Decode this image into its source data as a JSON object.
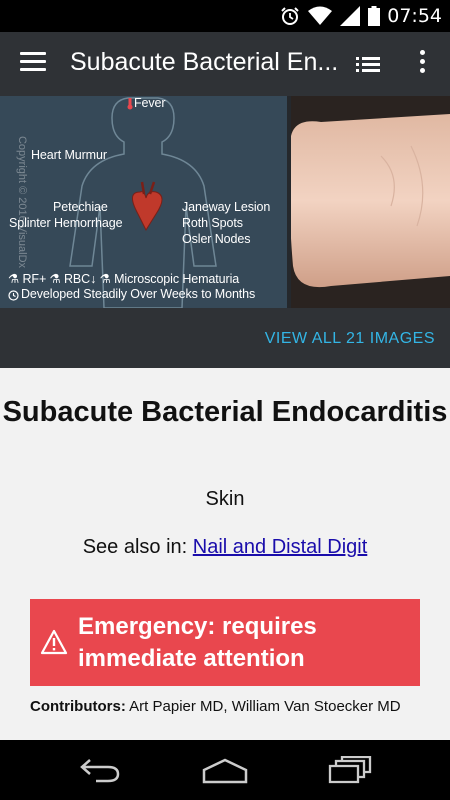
{
  "status_bar": {
    "time": "07:54"
  },
  "app_bar": {
    "title": "Subacute Bacterial En..."
  },
  "gallery": {
    "diagram_labels": {
      "fever": "Fever",
      "heart_murmur": "Heart Murmur",
      "petechiae": "Petechiae",
      "splinter": "Splinter Hemorrhage",
      "janeway": "Janeway Lesion",
      "roth": "Roth Spots",
      "osler": "Osler Nodes",
      "labs": "⚗ RF+   ⚗ RBC↓   ⚗ Microscopic Hematuria",
      "onset": "Developed Steadily Over Weeks to Months",
      "copyright": "Copyright © 2016 VisualDx"
    }
  },
  "view_all": {
    "label": "VIEW ALL 21 IMAGES"
  },
  "content": {
    "title": "Subacute Bacterial Endocarditis",
    "category": "Skin",
    "see_also_prefix": "See also in: ",
    "see_also_link": "Nail and Distal Digit",
    "emergency_text": "Emergency: requires immediate attention",
    "contributors_label": "Contributors:",
    "contributors_names": " Art Papier MD, William Van Stoecker MD"
  },
  "colors": {
    "app_bar": "#2f3236",
    "accent_link": "#33b5e5",
    "emergency": "#e9474e",
    "diagram_bg": "#364958"
  },
  "icons": [
    "hamburger-menu-icon",
    "list-view-icon",
    "overflow-menu-icon",
    "alarm-icon",
    "wifi-icon",
    "signal-icon",
    "battery-icon",
    "warning-icon",
    "back-icon",
    "home-icon",
    "recents-icon"
  ]
}
